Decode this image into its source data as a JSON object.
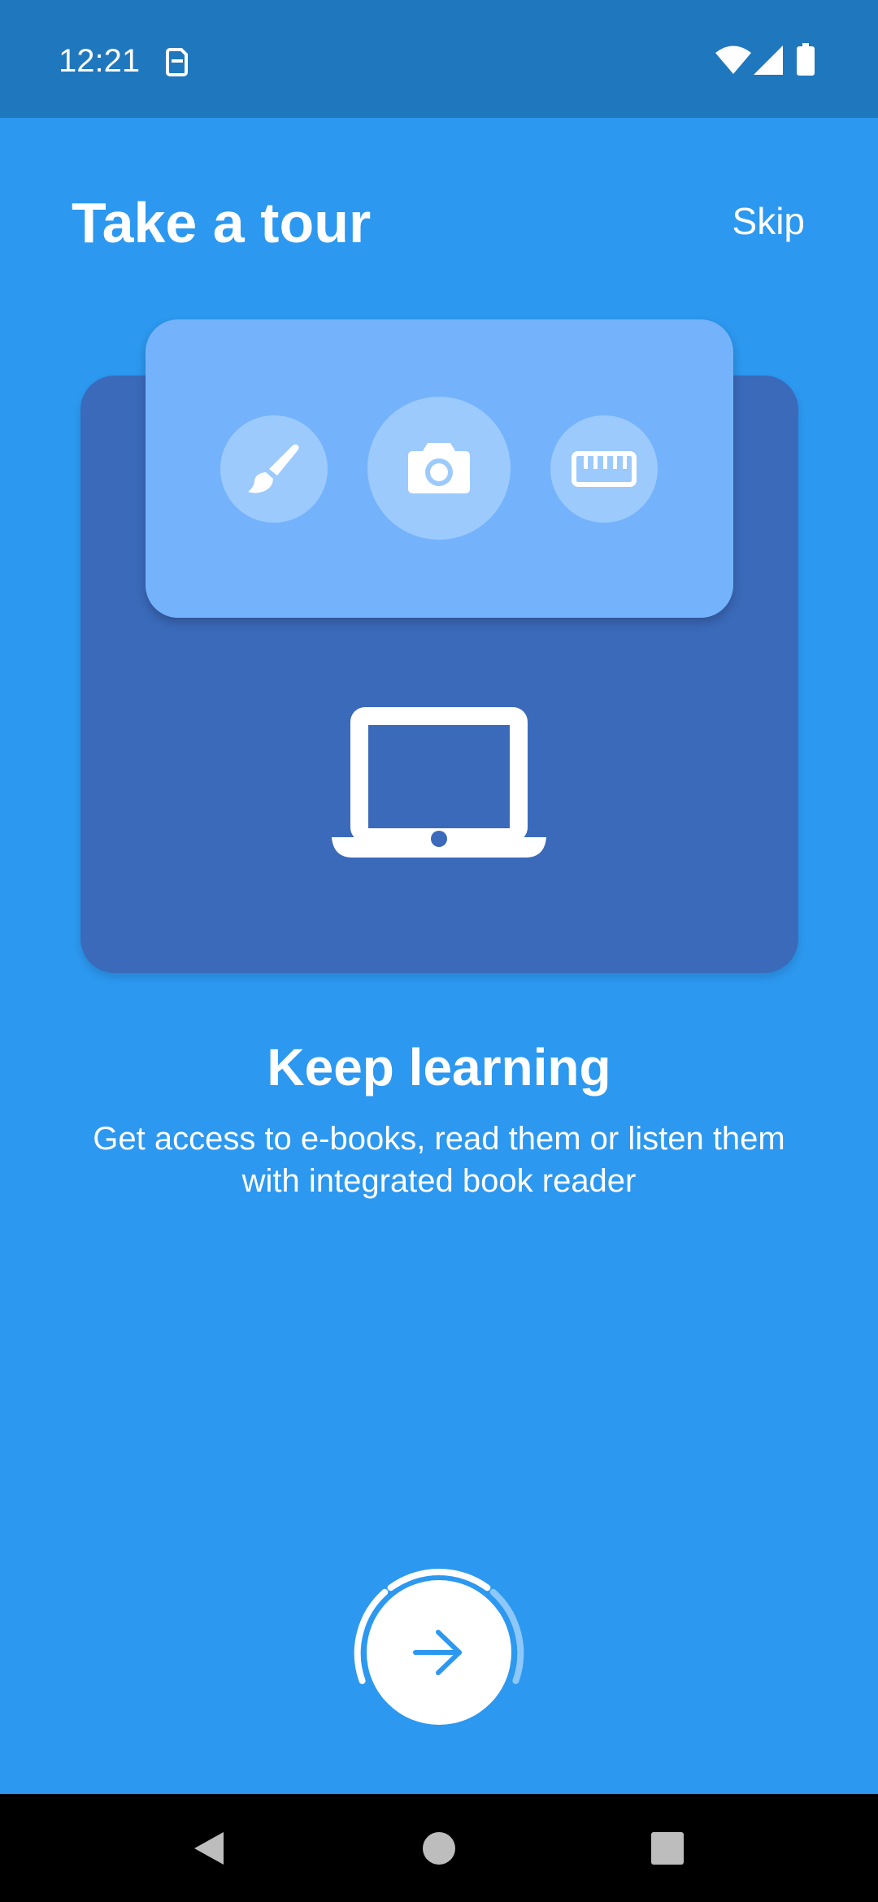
{
  "status_bar": {
    "time": "12:21",
    "icons": [
      "sim-icon",
      "wifi-icon",
      "signal-icon",
      "battery-icon"
    ]
  },
  "header": {
    "title": "Take a tour",
    "skip_label": "Skip"
  },
  "illustration": {
    "tools": [
      "brush-icon",
      "camera-icon",
      "ruler-icon"
    ],
    "device": "laptop-icon"
  },
  "content": {
    "heading": "Keep learning",
    "description": "Get access to e-books, read them or listen them with integrated book reader"
  },
  "next_button": {
    "icon": "arrow-right-icon"
  },
  "nav_bar": {
    "buttons": [
      "back-icon",
      "home-icon",
      "recents-icon"
    ]
  },
  "colors": {
    "background": "#2c98f0",
    "status_bar": "#1f77bd",
    "card_back": "#3b6abb",
    "card_front": "#74b3fc",
    "tool_circle": "#9ccafd",
    "accent": "#2c98f0"
  }
}
